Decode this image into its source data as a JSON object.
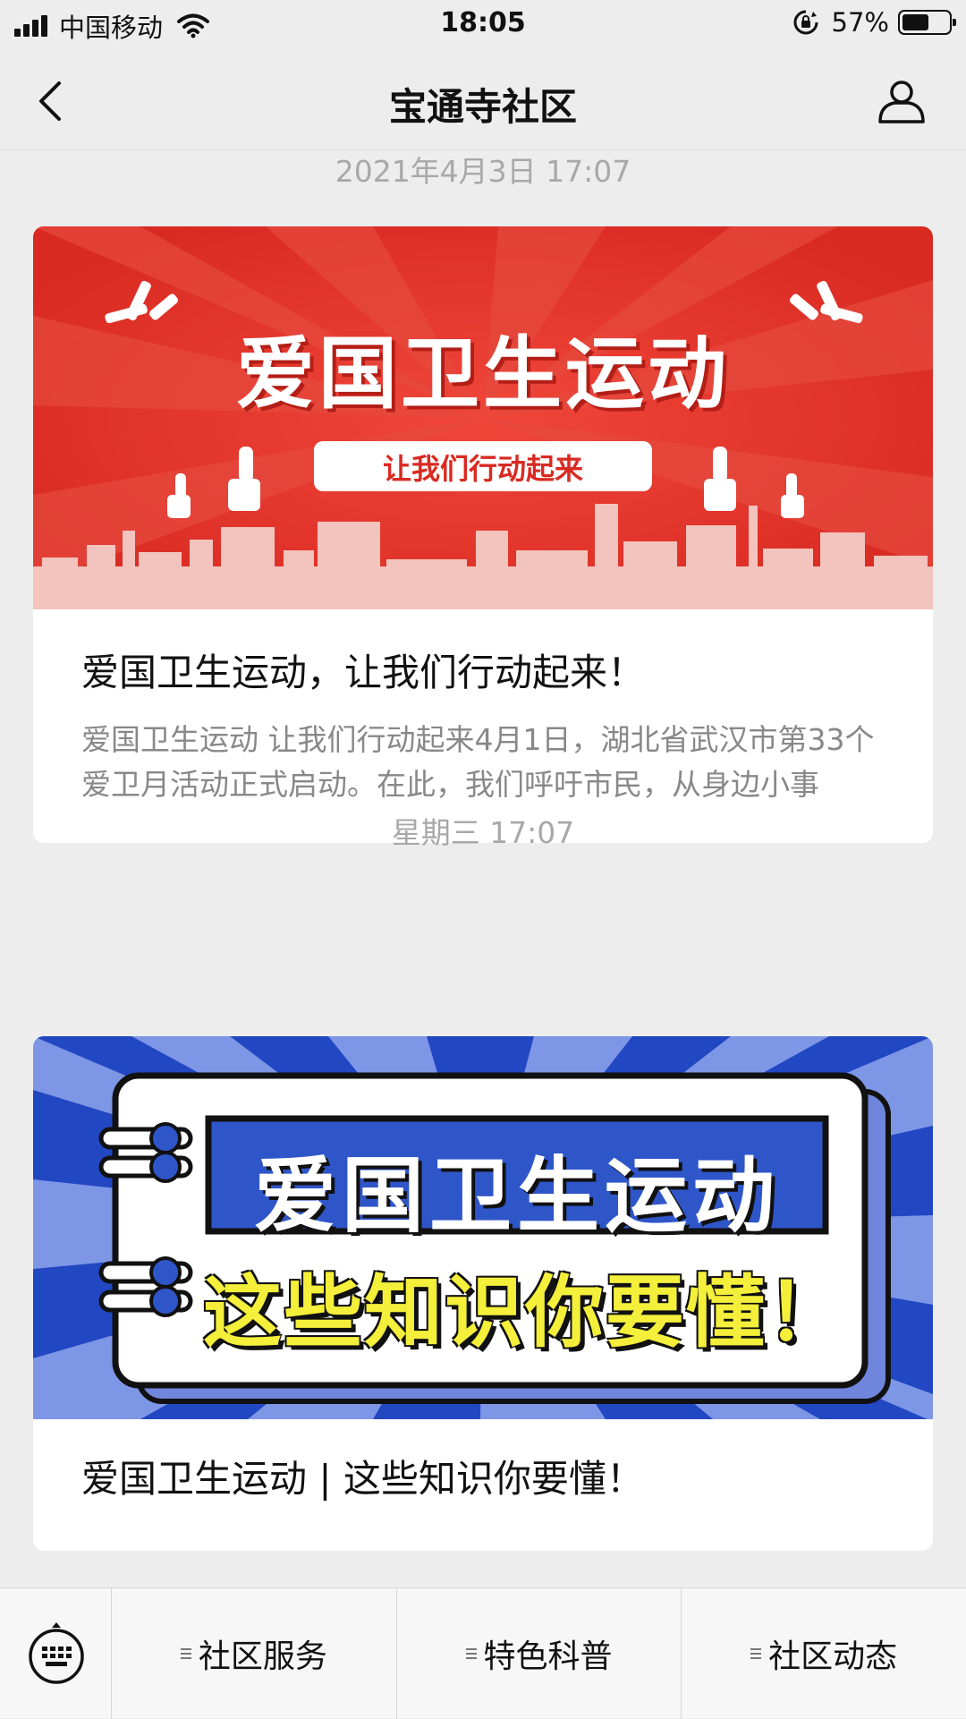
{
  "status_bar": {
    "carrier": "中国移动",
    "time": "18:05",
    "battery_percent": "57%",
    "battery_level": 0.57
  },
  "nav": {
    "title": "宝通寺社区"
  },
  "feed": [
    {
      "timestamp": "2021年4月3日 17:07",
      "banner": {
        "headline": "爱国卫生运动",
        "subline": "让我们行动起来",
        "bg_color": "#e8372c"
      },
      "title": "爱国卫生运动，让我们行动起来！",
      "description": "爱国卫生运动 让我们行动起来4月1日，湖北省武汉市第33个爱卫月活动正式启动。在此，我们呼吁市民，从身边小事"
    },
    {
      "timestamp": "星期三 17:07",
      "banner": {
        "headline": "爱国卫生运动",
        "subline": "这些知识你要懂！",
        "bg_color": "#2f56c9"
      },
      "title": "爱国卫生运动 | 这些知识你要懂！"
    }
  ],
  "tab_bar": {
    "keyboard_icon": "keyboard-icon",
    "tabs": [
      {
        "label": "社区服务"
      },
      {
        "label": "特色科普"
      },
      {
        "label": "社区动态"
      }
    ]
  }
}
